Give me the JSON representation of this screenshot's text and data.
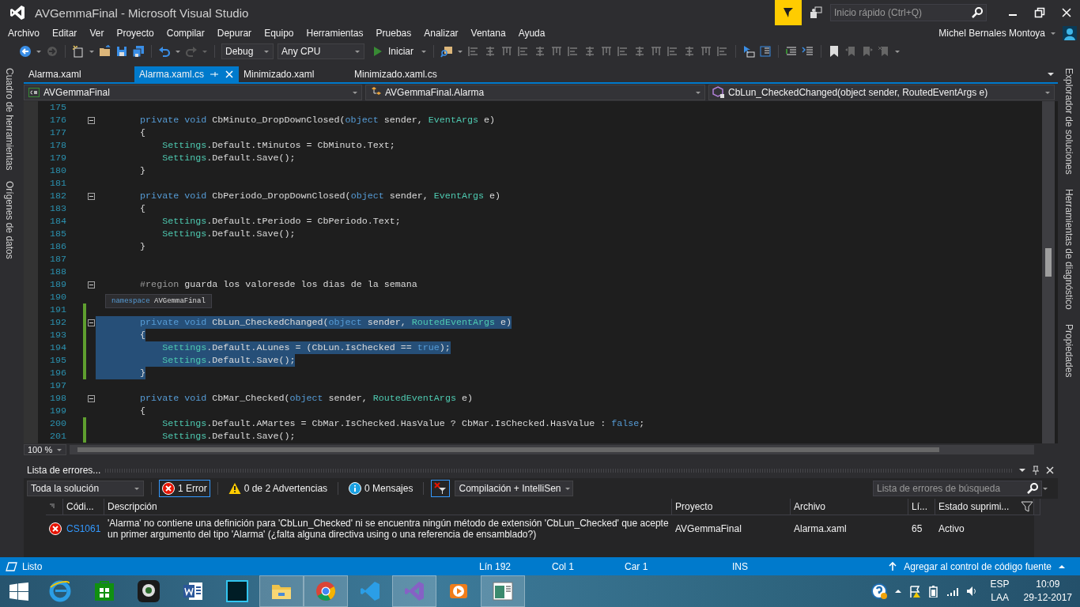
{
  "window": {
    "title": "AVGemmaFinal - Microsoft Visual Studio"
  },
  "quick_launch": {
    "placeholder": "Inicio rápido (Ctrl+Q)"
  },
  "menu": [
    "Archivo",
    "Editar",
    "Ver",
    "Proyecto",
    "Compilar",
    "Depurar",
    "Equipo",
    "Herramientas",
    "Pruebas",
    "Analizar",
    "Ventana",
    "Ayuda"
  ],
  "user": {
    "name": "Michel Bernales Montoya"
  },
  "toolbar": {
    "configuration": "Debug",
    "platform": "Any CPU",
    "start": "Iniciar"
  },
  "left_tool_tabs": [
    "Cuadro de herramientas",
    "Orígenes de datos"
  ],
  "right_tool_tabs": [
    "Explorador de soluciones",
    "Herramientas de diagnóstico",
    "Propiedades"
  ],
  "document_tabs": [
    {
      "label": "Alarma.xaml",
      "selected": false
    },
    {
      "label": "Alarma.xaml.cs",
      "selected": true
    },
    {
      "label": "Minimizado.xaml",
      "selected": false
    },
    {
      "label": "Minimizado.xaml.cs",
      "selected": false
    }
  ],
  "navigation": {
    "project": "AVGemmaFinal",
    "type": "AVGemmaFinal.Alarma",
    "member": "CbLun_CheckedChanged(object sender, RoutedEventArgs e)"
  },
  "editor": {
    "tooltip": {
      "keyword": "namespace",
      "name": "AVGemmaFinal"
    },
    "zoom": "100 %",
    "lines": [
      {
        "number": "175",
        "fold": false,
        "modified": false,
        "selected": false
      },
      {
        "number": "176",
        "fold": true,
        "modified": false,
        "selected": false,
        "kind": "member",
        "tokens": [
          {
            "kind": "keyword",
            "text": "private void"
          },
          {
            "kind": "plain",
            "text": " CbMinuto_DropDownClosed("
          },
          {
            "kind": "keyword",
            "text": "object"
          },
          {
            "kind": "plain",
            "text": " sender, "
          },
          {
            "kind": "type",
            "text": "EventArgs"
          },
          {
            "kind": "plain",
            "text": " e)"
          }
        ]
      },
      {
        "number": "177",
        "fold": false,
        "modified": false,
        "selected": false,
        "kind": "member",
        "tokens": [
          {
            "kind": "plain",
            "text": "{"
          }
        ]
      },
      {
        "number": "178",
        "fold": false,
        "modified": false,
        "selected": false,
        "kind": "statement",
        "tokens": [
          {
            "kind": "type",
            "text": "Settings"
          },
          {
            "kind": "plain",
            "text": ".Default.tMinutos = CbMinuto.Text;"
          }
        ]
      },
      {
        "number": "179",
        "fold": false,
        "modified": false,
        "selected": false,
        "kind": "statement",
        "tokens": [
          {
            "kind": "type",
            "text": "Settings"
          },
          {
            "kind": "plain",
            "text": ".Default.Save();"
          }
        ]
      },
      {
        "number": "180",
        "fold": false,
        "modified": false,
        "selected": false,
        "kind": "member",
        "tokens": [
          {
            "kind": "plain",
            "text": "}"
          }
        ]
      },
      {
        "number": "181",
        "fold": false,
        "modified": false,
        "selected": false
      },
      {
        "number": "182",
        "fold": true,
        "modified": false,
        "selected": false,
        "kind": "member",
        "tokens": [
          {
            "kind": "keyword",
            "text": "private void"
          },
          {
            "kind": "plain",
            "text": " CbPeriodo_DropDownClosed("
          },
          {
            "kind": "keyword",
            "text": "object"
          },
          {
            "kind": "plain",
            "text": " sender, "
          },
          {
            "kind": "type",
            "text": "EventArgs"
          },
          {
            "kind": "plain",
            "text": " e)"
          }
        ]
      },
      {
        "number": "183",
        "fold": false,
        "modified": false,
        "selected": false,
        "kind": "member",
        "tokens": [
          {
            "kind": "plain",
            "text": "{"
          }
        ]
      },
      {
        "number": "184",
        "fold": false,
        "modified": false,
        "selected": false,
        "kind": "statement",
        "tokens": [
          {
            "kind": "type",
            "text": "Settings"
          },
          {
            "kind": "plain",
            "text": ".Default.tPeriodo = CbPeriodo.Text;"
          }
        ]
      },
      {
        "number": "185",
        "fold": false,
        "modified": false,
        "selected": false,
        "kind": "statement",
        "tokens": [
          {
            "kind": "type",
            "text": "Settings"
          },
          {
            "kind": "plain",
            "text": ".Default.Save();"
          }
        ]
      },
      {
        "number": "186",
        "fold": false,
        "modified": false,
        "selected": false,
        "kind": "member",
        "tokens": [
          {
            "kind": "plain",
            "text": "}"
          }
        ]
      },
      {
        "number": "187",
        "fold": false,
        "modified": false,
        "selected": false
      },
      {
        "number": "188",
        "fold": false,
        "modified": false,
        "selected": false
      },
      {
        "number": "189",
        "fold": true,
        "modified": false,
        "selected": false,
        "kind": "member",
        "tokens": [
          {
            "kind": "preprocessor",
            "text": "#region"
          },
          {
            "kind": "plain",
            "text": " guarda los valoresde los dias de la semana"
          }
        ]
      },
      {
        "number": "190",
        "fold": false,
        "modified": false,
        "selected": false
      },
      {
        "number": "191",
        "fold": false,
        "modified": true,
        "selected": false
      },
      {
        "number": "192",
        "fold": true,
        "modified": true,
        "selected": true,
        "kind": "member",
        "tokens": [
          {
            "kind": "keyword",
            "text": "private void"
          },
          {
            "kind": "plain",
            "text": " CbLun_CheckedChanged("
          },
          {
            "kind": "keyword",
            "text": "object"
          },
          {
            "kind": "plain",
            "text": " sender, "
          },
          {
            "kind": "type",
            "text": "RoutedEventArgs"
          },
          {
            "kind": "plain",
            "text": " e)"
          }
        ]
      },
      {
        "number": "193",
        "fold": false,
        "modified": true,
        "selected": true,
        "kind": "member",
        "tokens": [
          {
            "kind": "plain",
            "text": "{"
          }
        ]
      },
      {
        "number": "194",
        "fold": false,
        "modified": true,
        "selected": true,
        "kind": "statement",
        "tokens": [
          {
            "kind": "type",
            "text": "Settings"
          },
          {
            "kind": "plain",
            "text": ".Default.ALunes = (CbLun.IsChecked == "
          },
          {
            "kind": "keyword",
            "text": "true"
          },
          {
            "kind": "plain",
            "text": ");"
          }
        ]
      },
      {
        "number": "195",
        "fold": false,
        "modified": true,
        "selected": true,
        "kind": "statement",
        "tokens": [
          {
            "kind": "type",
            "text": "Settings"
          },
          {
            "kind": "plain",
            "text": ".Default.Save();"
          }
        ]
      },
      {
        "number": "196",
        "fold": false,
        "modified": true,
        "selected": true,
        "kind": "member",
        "tokens": [
          {
            "kind": "plain",
            "text": "}"
          }
        ]
      },
      {
        "number": "197",
        "fold": false,
        "modified": false,
        "selected": false
      },
      {
        "number": "198",
        "fold": true,
        "modified": false,
        "selected": false,
        "kind": "member",
        "tokens": [
          {
            "kind": "keyword",
            "text": "private void"
          },
          {
            "kind": "plain",
            "text": " CbMar_Checked("
          },
          {
            "kind": "keyword",
            "text": "object"
          },
          {
            "kind": "plain",
            "text": " sender, "
          },
          {
            "kind": "type",
            "text": "RoutedEventArgs"
          },
          {
            "kind": "plain",
            "text": " e)"
          }
        ]
      },
      {
        "number": "199",
        "fold": false,
        "modified": false,
        "selected": false,
        "kind": "member",
        "tokens": [
          {
            "kind": "plain",
            "text": "{"
          }
        ]
      },
      {
        "number": "200",
        "fold": false,
        "modified": true,
        "selected": false,
        "kind": "statement",
        "tokens": [
          {
            "kind": "type",
            "text": "Settings"
          },
          {
            "kind": "plain",
            "text": ".Default.AMartes = CbMar.IsChecked.HasValue ? CbMar.IsChecked.HasValue : "
          },
          {
            "kind": "keyword",
            "text": "false"
          },
          {
            "kind": "plain",
            "text": ";"
          }
        ]
      },
      {
        "number": "201",
        "fold": false,
        "modified": true,
        "selected": false,
        "kind": "statement",
        "tokens": [
          {
            "kind": "type",
            "text": "Settings"
          },
          {
            "kind": "plain",
            "text": ".Default.Save();"
          }
        ]
      }
    ]
  },
  "error_list": {
    "title": "Lista de errores...",
    "scope": "Toda la solución",
    "filters": [
      {
        "kind": "error",
        "label": "1 Error",
        "selected": true
      },
      {
        "kind": "warning",
        "label": "0 de 2 Advertencias",
        "selected": false
      },
      {
        "kind": "info",
        "label": "0 Mensajes",
        "selected": false
      }
    ],
    "source": "Compilación + IntelliSen",
    "search": {
      "placeholder": "Lista de errores de búsqueda"
    },
    "columns": [
      "Códi...",
      "Descripción",
      "Proyecto",
      "Archivo",
      "Lí...",
      "Estado suprimi..."
    ],
    "rows": [
      {
        "kind": "error",
        "code": "CS1061",
        "description": "'Alarma' no contiene una definición para 'CbLun_Checked' ni se encuentra ningún método de extensión 'CbLun_Checked' que acepte un primer argumento del tipo 'Alarma' (¿falta alguna directiva using o una referencia de ensamblado?)",
        "project": "AVGemmaFinal",
        "file": "Alarma.xaml",
        "line": "65",
        "state": "Activo"
      }
    ]
  },
  "status_bar": {
    "message": "Listo",
    "line": "Lín 192",
    "column": "Col 1",
    "char": "Car 1",
    "mode": "INS",
    "source_control": "Agregar al control de código fuente"
  },
  "taskbar": {
    "language": "ESP",
    "layout": "LAA",
    "time": "10:09",
    "date": "29-12-2017"
  }
}
